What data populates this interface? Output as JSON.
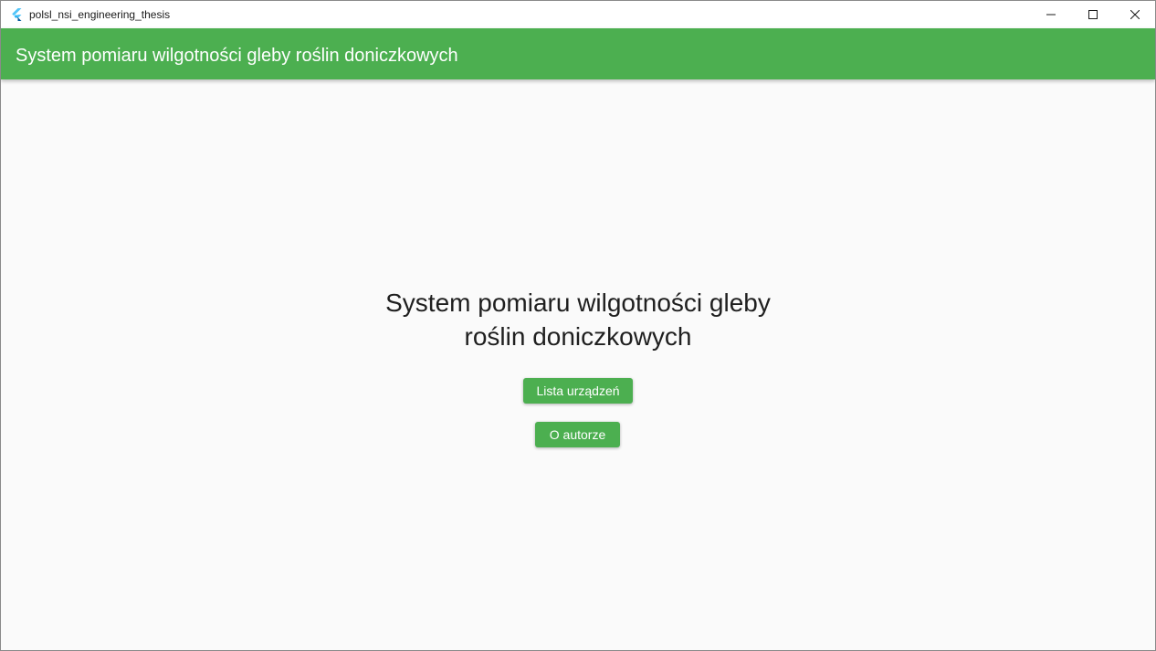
{
  "window": {
    "title": "polsl_nsi_engineering_thesis",
    "app_icon": "flutter-logo-icon",
    "controls": {
      "minimize_icon": "minimize-icon",
      "maximize_icon": "maximize-icon",
      "close_icon": "close-icon"
    }
  },
  "appbar": {
    "title": "System pomiaru wilgotności gleby roślin doniczkowych"
  },
  "main": {
    "heading_line1": "System pomiaru wilgotności gleby",
    "heading_line2": "roślin doniczkowych",
    "buttons": {
      "devices_label": "Lista urządzeń",
      "author_label": "O autorze"
    }
  },
  "colors": {
    "accent": "#4caf50",
    "background": "#fafafa",
    "text": "#1f1f1f"
  }
}
